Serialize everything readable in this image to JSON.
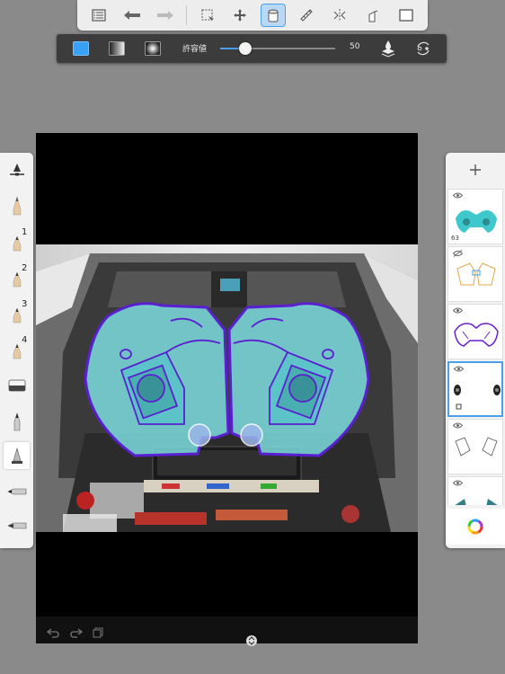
{
  "toolbar": {
    "icons": [
      "layer-list-icon",
      "undo-icon",
      "redo-icon",
      "selection-icon",
      "transform-icon",
      "fill-icon",
      "ruler-icon",
      "symmetry-icon",
      "perspective-icon",
      "fullscreen-icon"
    ],
    "active": "fill-icon",
    "active_color": "#4aa0e8"
  },
  "fill_options": {
    "tolerance_label": "許容値",
    "tolerance_value": "50",
    "tolerance_fraction": 0.22,
    "solid_color": "#3aa0f5"
  },
  "brushes": {
    "numbered": [
      "1",
      "2",
      "3",
      "4"
    ],
    "active": "airbrush"
  },
  "layers": {
    "count": 6,
    "selected_index": 3,
    "thumb_label": "63"
  },
  "colors": {
    "speaker_fill": "#7fe3e6",
    "speaker_outline": "#5a1fd0",
    "canvas_bg": "#000000"
  }
}
